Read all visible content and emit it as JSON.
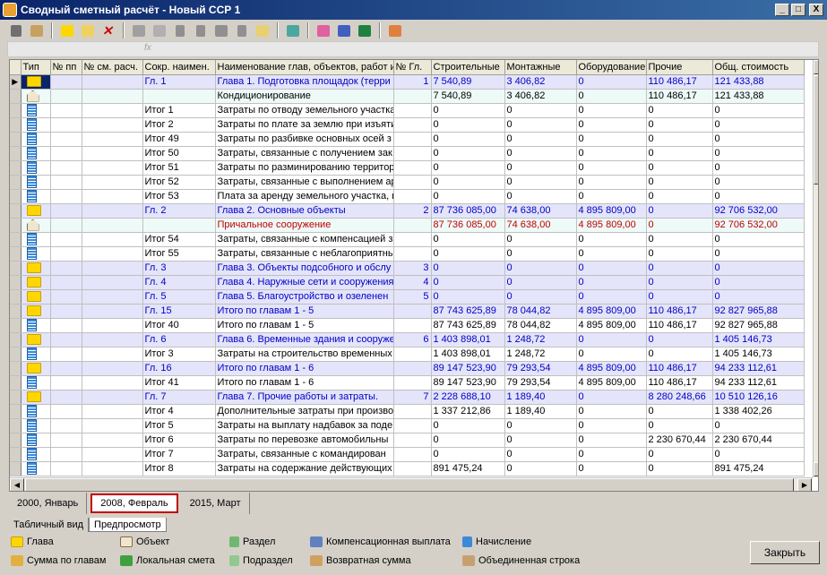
{
  "window": {
    "title": "Сводный сметный расчёт - Новый ССР 1",
    "min": "_",
    "max": "□",
    "close": "X"
  },
  "formula": {
    "fx": "fx"
  },
  "columns": [
    "Тип",
    "№ пп",
    "№ см. расч.",
    "Сокр. наимен.",
    "Наименование глав, объектов, работ и",
    "№ Гл.",
    "Строительные",
    "Монтажные",
    "Оборудование",
    "Прочие",
    "Общ. стоимость"
  ],
  "rows": [
    {
      "icon": "folder",
      "style": "chapter",
      "abbr": "Гл. 1",
      "name": "Глава  1. Подготовка площадок (терри",
      "ch": "1",
      "build": "7 540,89",
      "mont": "3 406,82",
      "equip": "0",
      "other": "110 486,17",
      "total": "121 433,88"
    },
    {
      "icon": "house",
      "style": "object",
      "abbr": "",
      "name": "Кондиционирование",
      "ch": "",
      "build": "7 540,89",
      "mont": "3 406,82",
      "equip": "0",
      "other": "110 486,17",
      "total": "121 433,88"
    },
    {
      "icon": "doc",
      "style": "",
      "abbr": "Итог 1",
      "name": "Затраты по отводу земельного участка",
      "ch": "",
      "build": "0",
      "mont": "0",
      "equip": "0",
      "other": "0",
      "total": "0"
    },
    {
      "icon": "doc",
      "style": "",
      "abbr": "Итог 2",
      "name": "Затраты по плате за землю при изъяти",
      "ch": "",
      "build": "0",
      "mont": "0",
      "equip": "0",
      "other": "0",
      "total": "0"
    },
    {
      "icon": "doc",
      "style": "",
      "abbr": "Итог 49",
      "name": "Затраты по разбивке основных осей з",
      "ch": "",
      "build": "0",
      "mont": "0",
      "equip": "0",
      "other": "0",
      "total": "0"
    },
    {
      "icon": "doc",
      "style": "",
      "abbr": "Итог 50",
      "name": "Затраты, связанные с получением зак",
      "ch": "",
      "build": "0",
      "mont": "0",
      "equip": "0",
      "other": "0",
      "total": "0"
    },
    {
      "icon": "doc",
      "style": "",
      "abbr": "Итог 51",
      "name": "Затраты по разминированию территор",
      "ch": "",
      "build": "0",
      "mont": "0",
      "equip": "0",
      "other": "0",
      "total": "0"
    },
    {
      "icon": "doc",
      "style": "",
      "abbr": "Итог 52",
      "name": "Затраты, связанные с выполнением ар",
      "ch": "",
      "build": "0",
      "mont": "0",
      "equip": "0",
      "other": "0",
      "total": "0"
    },
    {
      "icon": "doc",
      "style": "",
      "abbr": "Итог 53",
      "name": "Плата за аренду земельного участка, н",
      "ch": "",
      "build": "0",
      "mont": "0",
      "equip": "0",
      "other": "0",
      "total": "0"
    },
    {
      "icon": "folder",
      "style": "chapter",
      "abbr": "Гл. 2",
      "name": "Глава  2. Основные объекты",
      "ch": "2",
      "build": "87 736 085,00",
      "mont": "74 638,00",
      "equip": "4 895 809,00",
      "other": "0",
      "total": "92 706 532,00"
    },
    {
      "icon": "house",
      "style": "object red",
      "abbr": "",
      "name": "Причальное сооружение",
      "ch": "",
      "build": "87 736 085,00",
      "mont": "74 638,00",
      "equip": "4 895 809,00",
      "other": "0",
      "total": "92 706 532,00"
    },
    {
      "icon": "doc",
      "style": "",
      "abbr": "Итог 54",
      "name": "Затраты, связанные с компенсацией з",
      "ch": "",
      "build": "0",
      "mont": "0",
      "equip": "0",
      "other": "0",
      "total": "0"
    },
    {
      "icon": "doc",
      "style": "",
      "abbr": "Итог 55",
      "name": "Затраты, связанные с неблагоприятны",
      "ch": "",
      "build": "0",
      "mont": "0",
      "equip": "0",
      "other": "0",
      "total": "0"
    },
    {
      "icon": "folder",
      "style": "chapter",
      "abbr": "Гл. 3",
      "name": "Глава  3. Объекты подсобного и обслу",
      "ch": "3",
      "build": "0",
      "mont": "0",
      "equip": "0",
      "other": "0",
      "total": "0"
    },
    {
      "icon": "folder",
      "style": "chapter",
      "abbr": "Гл. 4",
      "name": "Глава  4. Наружные сети и сооружения",
      "ch": "4",
      "build": "0",
      "mont": "0",
      "equip": "0",
      "other": "0",
      "total": "0"
    },
    {
      "icon": "folder",
      "style": "chapter",
      "abbr": "Гл. 5",
      "name": "Глава  5. Благоустройство и озеленен",
      "ch": "5",
      "build": "0",
      "mont": "0",
      "equip": "0",
      "other": "0",
      "total": "0"
    },
    {
      "icon": "folder",
      "style": "chapter",
      "abbr": "Гл. 15",
      "name": "Итого по главам 1 - 5",
      "ch": "",
      "build": "87 743 625,89",
      "mont": "78 044,82",
      "equip": "4 895 809,00",
      "other": "110 486,17",
      "total": "92 827 965,88"
    },
    {
      "icon": "doc",
      "style": "",
      "abbr": "Итог 40",
      "name": "Итого по главам 1 - 5",
      "ch": "",
      "build": "87 743 625,89",
      "mont": "78 044,82",
      "equip": "4 895 809,00",
      "other": "110 486,17",
      "total": "92 827 965,88"
    },
    {
      "icon": "folder",
      "style": "chapter",
      "abbr": "Гл. 6",
      "name": "Глава  6. Временные здания и сооруже",
      "ch": "6",
      "build": "1 403 898,01",
      "mont": "1 248,72",
      "equip": "0",
      "other": "0",
      "total": "1 405 146,73"
    },
    {
      "icon": "doc",
      "style": "",
      "abbr": "Итог 3",
      "name": "Затраты на строительство временных",
      "ch": "",
      "build": "1 403 898,01",
      "mont": "1 248,72",
      "equip": "0",
      "other": "0",
      "total": "1 405 146,73"
    },
    {
      "icon": "folder",
      "style": "chapter",
      "abbr": "Гл. 16",
      "name": "Итого по главам 1 - 6",
      "ch": "",
      "build": "89 147 523,90",
      "mont": "79 293,54",
      "equip": "4 895 809,00",
      "other": "110 486,17",
      "total": "94 233 112,61"
    },
    {
      "icon": "doc",
      "style": "",
      "abbr": "Итог 41",
      "name": "Итого по главам 1 - 6",
      "ch": "",
      "build": "89 147 523,90",
      "mont": "79 293,54",
      "equip": "4 895 809,00",
      "other": "110 486,17",
      "total": "94 233 112,61"
    },
    {
      "icon": "folder",
      "style": "chapter",
      "abbr": "Гл. 7",
      "name": "Глава  7. Прочие работы и затраты.",
      "ch": "7",
      "build": "2 228 688,10",
      "mont": "1 189,40",
      "equip": "0",
      "other": "8 280 248,66",
      "total": "10 510 126,16"
    },
    {
      "icon": "doc",
      "style": "",
      "abbr": "Итог 4",
      "name": "Дополнительные затраты при произво",
      "ch": "",
      "build": "1 337 212,86",
      "mont": "1 189,40",
      "equip": "0",
      "other": "0",
      "total": "1 338 402,26"
    },
    {
      "icon": "doc",
      "style": "",
      "abbr": "Итог 5",
      "name": "Затраты  на выплату надбавок за поде",
      "ch": "",
      "build": "0",
      "mont": "0",
      "equip": "0",
      "other": "0",
      "total": "0"
    },
    {
      "icon": "doc",
      "style": "",
      "abbr": "Итог 6",
      "name": "Затраты по перевозке автомобильны",
      "ch": "",
      "build": "0",
      "mont": "0",
      "equip": "0",
      "other": "2 230 670,44",
      "total": "2 230 670,44"
    },
    {
      "icon": "doc",
      "style": "",
      "abbr": "Итог 7",
      "name": "Затраты, связанные с командирован",
      "ch": "",
      "build": "0",
      "mont": "0",
      "equip": "0",
      "other": "0",
      "total": "0"
    },
    {
      "icon": "doc",
      "style": "",
      "abbr": "Итог 8",
      "name": "Затраты на содержание действующих",
      "ch": "",
      "build": "891 475,24",
      "mont": "0",
      "equip": "0",
      "other": "0",
      "total": "891 475,24"
    }
  ],
  "year_tabs": [
    "2000, Январь",
    "2008, Февраль",
    "2015, Март"
  ],
  "view_tabs": [
    "Табличный вид",
    "Предпросмотр"
  ],
  "legend": {
    "glava": "Глава",
    "obekt": "Объект",
    "razdel": "Раздел",
    "komp": "Компенсационная выплата",
    "nach": "Начисление",
    "summa": "Сумма по главам",
    "lok": "Локальная смета",
    "podrazdel": "Подраздел",
    "vozvr": "Возвратная сумма",
    "obed": "Объединенная строка"
  },
  "close_label": "Закрыть",
  "colors": {
    "chapter_bg": "#e4e4fa",
    "chapter_text": "#0000c8",
    "red_text": "#c00000",
    "title_bar": "#0a246a"
  }
}
